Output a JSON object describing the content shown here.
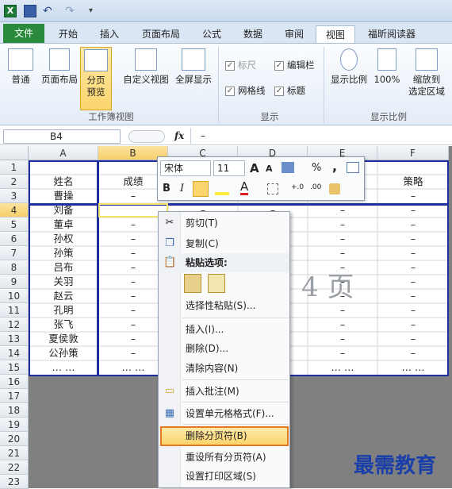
{
  "tabs": [
    "文件",
    "开始",
    "插入",
    "页面布局",
    "公式",
    "数据",
    "审阅",
    "视图",
    "福昕阅读器"
  ],
  "ribbon": {
    "buttons": [
      "普通",
      "页面布局",
      "分页\n预览",
      "自定义视图",
      "全屏显示",
      "显示比例",
      "100%",
      "缩放到\n选定区域"
    ],
    "checks": [
      "标尺",
      "编辑栏",
      "网格线",
      "标题"
    ],
    "groups": [
      "工作簿视图",
      "显示",
      "显示比例"
    ]
  },
  "formula": {
    "name_box": "B4",
    "fx": "fx",
    "value": "–"
  },
  "columns": [
    "A",
    "B",
    "C",
    "D",
    "E",
    "F"
  ],
  "rows": [
    "1",
    "2",
    "3",
    "4",
    "5",
    "6",
    "7",
    "8",
    "9",
    "10",
    "11",
    "12",
    "13",
    "14",
    "15",
    "16",
    "17",
    "18",
    "19",
    "20",
    "21",
    "22",
    "23"
  ],
  "col_a": [
    "",
    "姓名",
    "曹操",
    "刘备",
    "董卓",
    "孙权",
    "孙策",
    "吕布",
    "关羽",
    "赵云",
    "孔明",
    "张飞",
    "夏侯敦",
    "公孙策",
    "… …"
  ],
  "col_b": [
    "",
    "成绩",
    "–",
    "",
    "–",
    "–",
    "–",
    "–",
    "–",
    "–",
    "–",
    "–",
    "–",
    "–",
    "… …"
  ],
  "col_f": [
    "",
    "策略",
    "–",
    "–",
    "–",
    "–",
    "–",
    "–",
    "–",
    "–",
    "–",
    "–",
    "–",
    "–",
    "… …"
  ],
  "dash": "–",
  "ellipsis": "… …",
  "watermark": "4 页",
  "mini_toolbar": {
    "font": "宋体",
    "size": "11",
    "bold": "B",
    "italic": "I",
    "percent": "%",
    "comma": ",",
    "inc": "A",
    "dec": "A"
  },
  "menu": {
    "cut": "剪切(T)",
    "copy": "复制(C)",
    "paste_header": "粘贴选项:",
    "paste_special": "选择性粘贴(S)...",
    "insert": "插入(I)...",
    "delete": "删除(D)...",
    "clear": "清除内容(N)",
    "insert_comment": "插入批注(M)",
    "format_cells": "设置单元格格式(F)...",
    "delete_break": "删除分页符(B)",
    "reset_breaks": "重设所有分页符(A)",
    "print_area": "设置打印区域(S)"
  },
  "logo": "最需教育",
  "colors": {
    "file_tab": "#2a8a3c",
    "page_border": "#1f2f9f",
    "highlight": "#e07a22"
  }
}
